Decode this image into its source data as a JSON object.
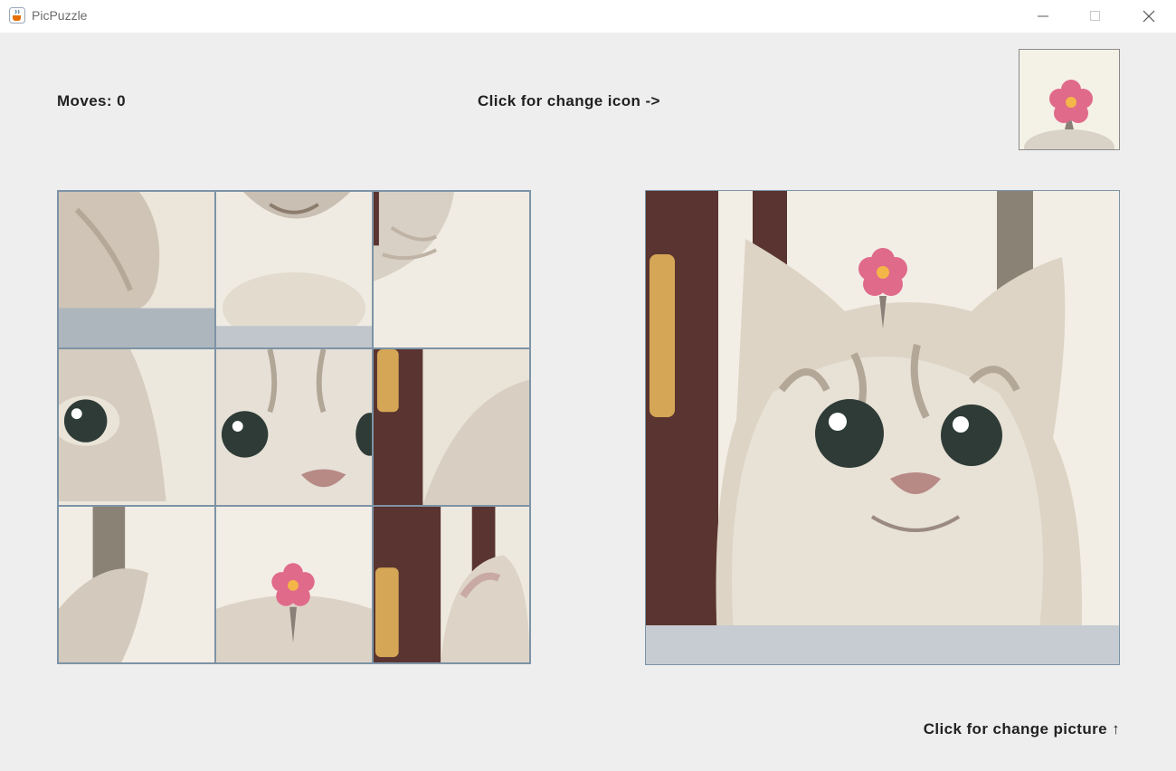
{
  "window": {
    "title": "PicPuzzle"
  },
  "header": {
    "moves_label": "Moves: 0",
    "change_icon_label": "Click for change icon ->"
  },
  "footer": {
    "change_picture_label": "Click for change picture ↑"
  },
  "icons": {
    "app": "java-cup-icon",
    "minimize": "minimize-icon",
    "maximize": "maximize-icon",
    "close": "close-icon",
    "preview": "flower-icon"
  },
  "puzzle": {
    "grid": "3x3",
    "tiles": [
      "cat-left-ear-edge",
      "cat-chin",
      "cat-right-cheek-fur",
      "cat-left-eye",
      "cat-right-eye-and-nose",
      "door-and-cat-cheek",
      "cat-right-ear",
      "flower-on-head",
      "door-and-cat-left-ear"
    ]
  },
  "colors": {
    "background": "#eeeeee",
    "tile_border": "#7d93a6",
    "flower": "#e06a8a",
    "door": "#5a3430"
  }
}
